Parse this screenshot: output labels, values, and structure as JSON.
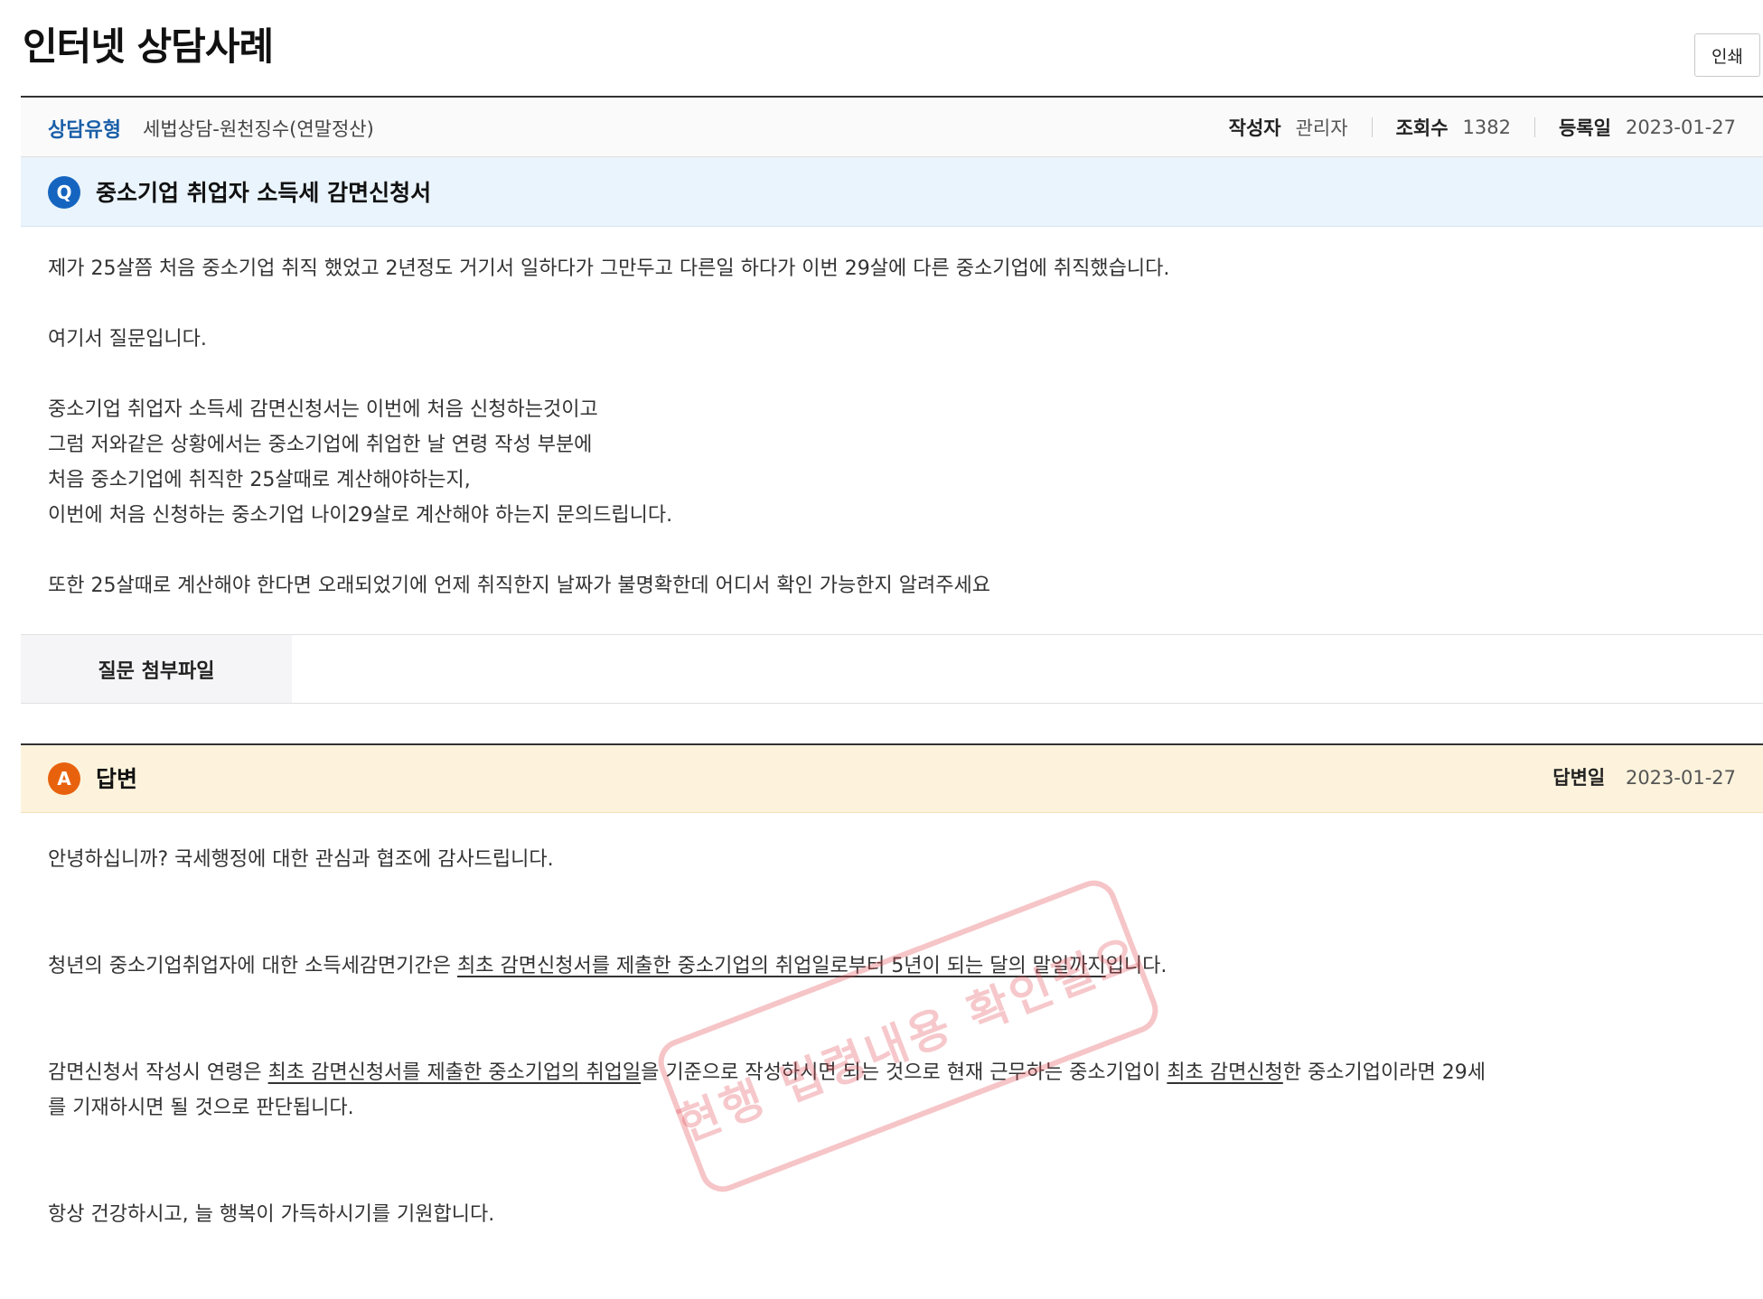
{
  "header": {
    "title": "인터넷 상담사례",
    "print_label": "인쇄"
  },
  "meta": {
    "type_label": "상담유형",
    "type_value": "세법상담-원천징수(연말정산)",
    "author_label": "작성자",
    "author_value": "관리자",
    "views_label": "조회수",
    "views_value": "1382",
    "date_label": "등록일",
    "date_value": "2023-01-27"
  },
  "question": {
    "badge": "Q",
    "title": "중소기업 취업자 소득세 감면신청서",
    "paragraphs": [
      "제가 25살쯤 처음 중소기업 취직 했었고 2년정도 거기서 일하다가 그만두고 다른일 하다가 이번 29살에 다른 중소기업에 취직했습니다.",
      "",
      "여기서 질문입니다.",
      "",
      "중소기업 취업자 소득세 감면신청서는 이번에 처음 신청하는것이고",
      "그럼 저와같은 상황에서는 중소기업에 취업한 날 연령 작성 부분에",
      "처음 중소기업에 취직한 25살때로 계산해야하는지,",
      "이번에 처음 신청하는 중소기업 나이29살로 계산해야 하는지 문의드립니다.",
      "",
      "또한 25살때로 계산해야 한다면 오래되었기에 언제 취직한지 날짜가 불명확한데 어디서 확인 가능한지 알려주세요"
    ],
    "attachment_label": "질문 첨부파일"
  },
  "answer": {
    "badge": "A",
    "title": "답변",
    "date_label": "답변일",
    "date_value": "2023-01-27",
    "greeting": "안녕하십니까? 국세행정에 대한 관심과 협조에 감사드립니다.",
    "para1_pre": "청년의 중소기업취업자에 대한 소득세감면기간은 ",
    "para1_u": "최초 감면신청서를 제출한 중소기업의 취업일로부터 5년이 되는 달의 말일까지",
    "para1_post": "입니다.",
    "para2_pre": "감면신청서 작성시 연령은 ",
    "para2_u1": "최초 감면신청서를 제출한 중소기업의 취업일",
    "para2_mid": "을 기준으로 작성하시면 되는 것으로 현재 근무하는 중소기업이 ",
    "para2_u2": "최초 감면신청",
    "para2_post": "한 중소기업이라면 29세",
    "para2_line2": "를 기재하시면 될 것으로 판단됩니다.",
    "closing": "항상 건강하시고, 늘 행복이 가득하시기를 기원합니다."
  },
  "watermark": {
    "text": "현행 법령내용 확인필요",
    "color": "#e24a52"
  }
}
